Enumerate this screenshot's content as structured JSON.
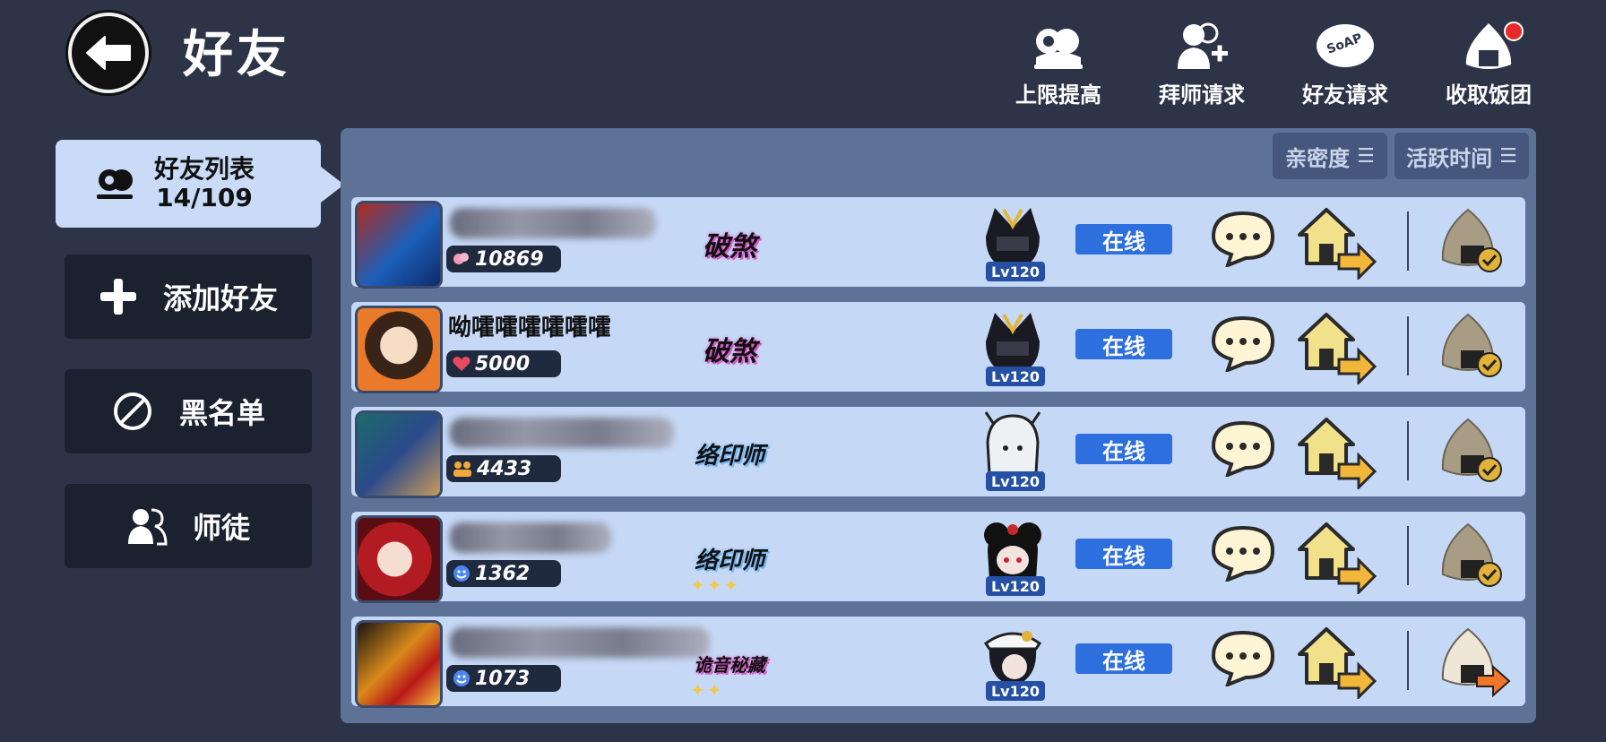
{
  "header": {
    "title": "好友",
    "actions": [
      {
        "label": "上限提高",
        "icon": "raise-limit-icon"
      },
      {
        "label": "拜师请求",
        "icon": "mentor-request-icon"
      },
      {
        "label": "好友请求",
        "icon": "friend-request-icon"
      },
      {
        "label": "收取饭团",
        "icon": "collect-riceball-icon",
        "badge": true
      }
    ]
  },
  "sidebar": {
    "active_tab": {
      "label": "好友列表",
      "count": "14/109"
    },
    "items": [
      {
        "label": "添加好友",
        "icon": "plus-icon"
      },
      {
        "label": "黑名单",
        "icon": "block-icon"
      },
      {
        "label": "师徒",
        "icon": "mentor-icon"
      }
    ]
  },
  "sort": {
    "intimacy": "亲密度",
    "activity": "活跃时间"
  },
  "friends": [
    {
      "name": "",
      "score": "10869",
      "title": "破煞",
      "level": "Lv120",
      "status": "在线",
      "gift_state": "collected"
    },
    {
      "name": "呦嚯嚯嚯嚯嚯嚯",
      "score": "5000",
      "title": "破煞",
      "level": "Lv120",
      "status": "在线",
      "gift_state": "collected"
    },
    {
      "name": "",
      "score": "4433",
      "title": "络印师",
      "level": "Lv120",
      "status": "在线",
      "gift_state": "collected"
    },
    {
      "name": "",
      "score": "1362",
      "title": "络印师",
      "level": "Lv120",
      "status": "在线",
      "gift_state": "collected"
    },
    {
      "name": "",
      "score": "1073",
      "title": "诡音秘藏",
      "level": "Lv120",
      "status": "在线",
      "gift_state": "send"
    }
  ],
  "colors": {
    "background": "#2e3448",
    "panel": "#5e7197",
    "row": "#c5d8f6",
    "online": "#2e6fe0",
    "level_badge": "#2550a4"
  }
}
